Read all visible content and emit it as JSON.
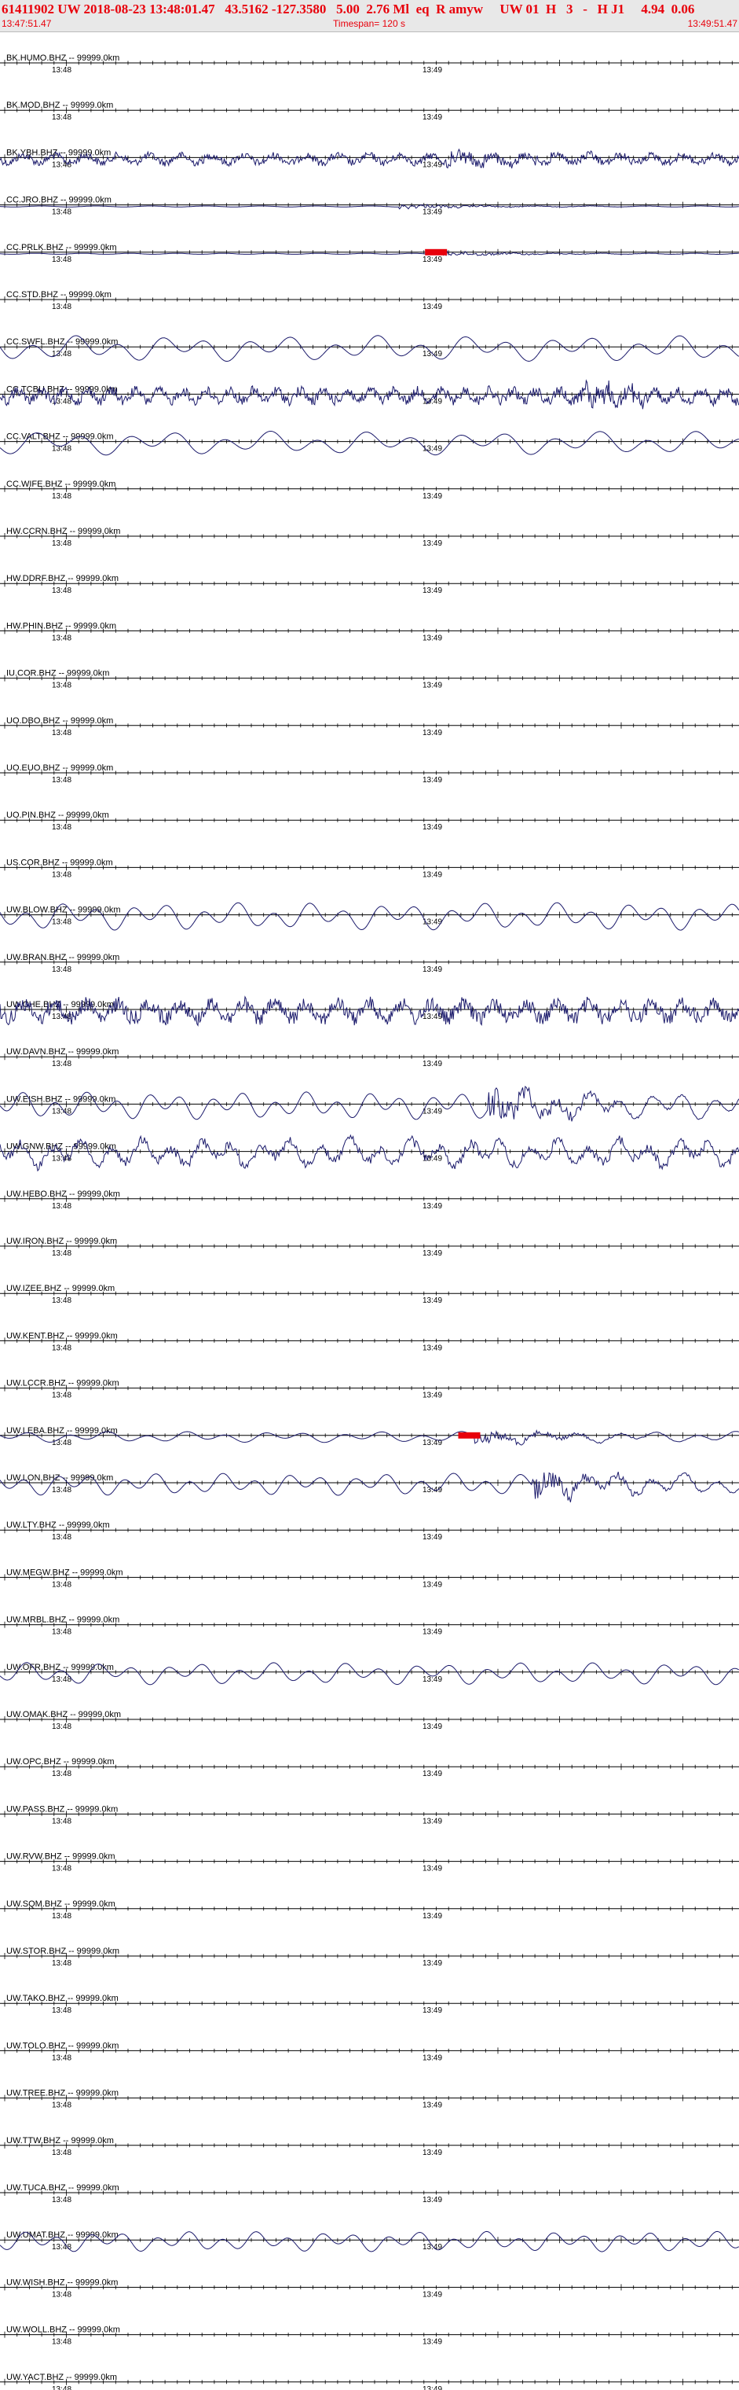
{
  "header": {
    "title": "61411902 UW 2018-08-23 13:48:01.47   43.5162 -127.3580   5.00  2.76 Ml  eq  R amyw     UW 01  H   3   -   H J1     4.94  0.06",
    "start_time": "13:47:51.47",
    "end_time": "13:49:51.47",
    "timespan": "Timespan= 120 s"
  },
  "tick_labels": {
    "first": "13:48",
    "second": "13:49"
  },
  "colors": {
    "trace": "#1b1a6b",
    "pick": "#e8000b",
    "header_text": "#e8000b",
    "axis": "#000000"
  },
  "chart_data": {
    "type": "line",
    "title": "61411902 UW 2018-08-23 13:48:01.47   43.5162 -127.3580   5.00  2.76 Ml  eq  R amyw     UW 01  H   3   -   H J1     4.94  0.06",
    "xlabel": "",
    "ylabel": "",
    "x_range": [
      "13:47:51.47",
      "13:49:51.47"
    ],
    "timespan_s": 120,
    "series": [
      {
        "name": "BK.HUMO.BHZ -- 99999.0km",
        "signal": "none",
        "amplitude": 0,
        "period": 0,
        "onset_frac": null,
        "pick_frac": null
      },
      {
        "name": "BK.MOD.BHZ -- 99999.0km",
        "signal": "none",
        "amplitude": 0,
        "period": 0,
        "onset_frac": null,
        "pick_frac": null
      },
      {
        "name": "BK.YBH.BHZ -- 99999.0km",
        "signal": "noise",
        "amplitude": 0.4,
        "period": 40,
        "onset_frac": 0.6,
        "pick_frac": null
      },
      {
        "name": "CC.JRO.BHZ -- 99999.0km",
        "signal": "quiet",
        "amplitude": 0.12,
        "period": 70,
        "onset_frac": 0.54,
        "pick_frac": null
      },
      {
        "name": "CC.PRLK.BHZ -- 99999.0km",
        "signal": "quiet",
        "amplitude": 0.12,
        "period": 60,
        "onset_frac": 0.6,
        "pick_frac": 0.59
      },
      {
        "name": "CC.STD.BHZ -- 99999.0km",
        "signal": "none",
        "amplitude": 0,
        "period": 0,
        "onset_frac": null,
        "pick_frac": null
      },
      {
        "name": "CC.SWFL.BHZ -- 99999.0km",
        "signal": "wave",
        "amplitude": 0.7,
        "period": 55,
        "onset_frac": null,
        "pick_frac": null
      },
      {
        "name": "CC.TCBU.BHZ -- 99999.0km",
        "signal": "noise",
        "amplitude": 0.55,
        "period": 30,
        "onset_frac": 0.78,
        "pick_frac": null
      },
      {
        "name": "CC.VALT.BHZ -- 99999.0km",
        "signal": "wave",
        "amplitude": 0.65,
        "period": 60,
        "onset_frac": null,
        "pick_frac": null
      },
      {
        "name": "CC.WIFE.BHZ -- 99999.0km",
        "signal": "none",
        "amplitude": 0,
        "period": 0,
        "onset_frac": null,
        "pick_frac": null
      },
      {
        "name": "HW.CCRN.BHZ -- 99999.0km",
        "signal": "none",
        "amplitude": 0,
        "period": 0,
        "onset_frac": null,
        "pick_frac": null
      },
      {
        "name": "HW.DDRF.BHZ -- 99999.0km",
        "signal": "none",
        "amplitude": 0,
        "period": 0,
        "onset_frac": null,
        "pick_frac": null
      },
      {
        "name": "HW.PHIN.BHZ -- 99999.0km",
        "signal": "none",
        "amplitude": 0,
        "period": 0,
        "onset_frac": null,
        "pick_frac": null
      },
      {
        "name": "IU.COR.BHZ -- 99999.0km",
        "signal": "none",
        "amplitude": 0,
        "period": 0,
        "onset_frac": null,
        "pick_frac": null
      },
      {
        "name": "UO.DBO.BHZ -- 99999.0km",
        "signal": "none",
        "amplitude": 0,
        "period": 0,
        "onset_frac": null,
        "pick_frac": null
      },
      {
        "name": "UO.EUO.BHZ -- 99999.0km",
        "signal": "none",
        "amplitude": 0,
        "period": 0,
        "onset_frac": null,
        "pick_frac": null
      },
      {
        "name": "UO.PIN.BHZ -- 99999.0km",
        "signal": "none",
        "amplitude": 0,
        "period": 0,
        "onset_frac": null,
        "pick_frac": null
      },
      {
        "name": "US.COR.BHZ -- 99999.0km",
        "signal": "none",
        "amplitude": 0,
        "period": 0,
        "onset_frac": null,
        "pick_frac": null
      },
      {
        "name": "UW.BLOW.BHZ -- 99999.0km",
        "signal": "wave",
        "amplitude": 0.75,
        "period": 45,
        "onset_frac": null,
        "pick_frac": null
      },
      {
        "name": "UW.BRAN.BHZ -- 99999.0km",
        "signal": "none",
        "amplitude": 0,
        "period": 0,
        "onset_frac": null,
        "pick_frac": null
      },
      {
        "name": "UW.CHE.BHZ -- 99999.0km",
        "signal": "noise",
        "amplitude": 0.8,
        "period": 40,
        "onset_frac": null,
        "pick_frac": null
      },
      {
        "name": "UW.DAVN.BHZ -- 99999.0km",
        "signal": "none",
        "amplitude": 0,
        "period": 0,
        "onset_frac": null,
        "pick_frac": null
      },
      {
        "name": "UW.EISH.BHZ -- 99999.0km",
        "signal": "wave",
        "amplitude": 0.75,
        "period": 40,
        "onset_frac": 0.66,
        "pick_frac": null
      },
      {
        "name": "UW.GNW.BHZ -- 99999.0km",
        "signal": "noisy-wave",
        "amplitude": 0.75,
        "period": 38,
        "onset_frac": null,
        "pick_frac": null
      },
      {
        "name": "UW.HEBO.BHZ -- 99999.0km",
        "signal": "none",
        "amplitude": 0,
        "period": 0,
        "onset_frac": null,
        "pick_frac": null
      },
      {
        "name": "UW.IRON.BHZ -- 99999.0km",
        "signal": "none",
        "amplitude": 0,
        "period": 0,
        "onset_frac": null,
        "pick_frac": null
      },
      {
        "name": "UW.IZEE.BHZ -- 99999.0km",
        "signal": "none",
        "amplitude": 0,
        "period": 0,
        "onset_frac": null,
        "pick_frac": null
      },
      {
        "name": "UW.KENT.BHZ -- 99999.0km",
        "signal": "none",
        "amplitude": 0,
        "period": 0,
        "onset_frac": null,
        "pick_frac": null
      },
      {
        "name": "UW.LCCR.BHZ -- 99999.0km",
        "signal": "none",
        "amplitude": 0,
        "period": 0,
        "onset_frac": null,
        "pick_frac": null
      },
      {
        "name": "UW.LEBA.BHZ -- 99999.0km",
        "signal": "wave",
        "amplitude": 0.3,
        "period": 50,
        "onset_frac": 0.64,
        "pick_frac": 0.635
      },
      {
        "name": "UW.LON.BHZ -- 99999.0km",
        "signal": "wave",
        "amplitude": 0.6,
        "period": 42,
        "onset_frac": 0.72,
        "pick_frac": null
      },
      {
        "name": "UW.LTY.BHZ -- 99999.0km",
        "signal": "none",
        "amplitude": 0,
        "period": 0,
        "onset_frac": null,
        "pick_frac": null
      },
      {
        "name": "UW.MEGW.BHZ -- 99999.0km",
        "signal": "none",
        "amplitude": 0,
        "period": 0,
        "onset_frac": null,
        "pick_frac": null
      },
      {
        "name": "UW.MRBL.BHZ -- 99999.0km",
        "signal": "none",
        "amplitude": 0,
        "period": 0,
        "onset_frac": null,
        "pick_frac": null
      },
      {
        "name": "UW.OFR.BHZ -- 99999.0km",
        "signal": "wave",
        "amplitude": 0.6,
        "period": 45,
        "onset_frac": null,
        "pick_frac": null
      },
      {
        "name": "UW.OMAK.BHZ -- 99999.0km",
        "signal": "none",
        "amplitude": 0,
        "period": 0,
        "onset_frac": null,
        "pick_frac": null
      },
      {
        "name": "UW.OPC.BHZ -- 99999.0km",
        "signal": "none",
        "amplitude": 0,
        "period": 0,
        "onset_frac": null,
        "pick_frac": null
      },
      {
        "name": "UW.PASS.BHZ -- 99999.0km",
        "signal": "none",
        "amplitude": 0,
        "period": 0,
        "onset_frac": null,
        "pick_frac": null
      },
      {
        "name": "UW.RVW.BHZ -- 99999.0km",
        "signal": "none",
        "amplitude": 0,
        "period": 0,
        "onset_frac": null,
        "pick_frac": null
      },
      {
        "name": "UW.SQM.BHZ -- 99999.0km",
        "signal": "none",
        "amplitude": 0,
        "period": 0,
        "onset_frac": null,
        "pick_frac": null
      },
      {
        "name": "UW.STOR.BHZ -- 99999.0km",
        "signal": "none",
        "amplitude": 0,
        "period": 0,
        "onset_frac": null,
        "pick_frac": null
      },
      {
        "name": "UW.TAKO.BHZ -- 99999.0km",
        "signal": "none",
        "amplitude": 0,
        "period": 0,
        "onset_frac": null,
        "pick_frac": null
      },
      {
        "name": "UW.TOLO.BHZ -- 99999.0km",
        "signal": "none",
        "amplitude": 0,
        "period": 0,
        "onset_frac": null,
        "pick_frac": null
      },
      {
        "name": "UW.TREE.BHZ -- 99999.0km",
        "signal": "none",
        "amplitude": 0,
        "period": 0,
        "onset_frac": null,
        "pick_frac": null
      },
      {
        "name": "UW.TTW.BHZ -- 99999.0km",
        "signal": "none",
        "amplitude": 0,
        "period": 0,
        "onset_frac": null,
        "pick_frac": null
      },
      {
        "name": "UW.TUCA.BHZ -- 99999.0km",
        "signal": "none",
        "amplitude": 0,
        "period": 0,
        "onset_frac": null,
        "pick_frac": null
      },
      {
        "name": "UW.UMAT.BHZ -- 99999.0km",
        "signal": "wave",
        "amplitude": 0.55,
        "period": 42,
        "onset_frac": null,
        "pick_frac": null
      },
      {
        "name": "UW.WISH.BHZ -- 99999.0km",
        "signal": "none",
        "amplitude": 0,
        "period": 0,
        "onset_frac": null,
        "pick_frac": null
      },
      {
        "name": "UW.WOLL.BHZ -- 99999.0km",
        "signal": "none",
        "amplitude": 0,
        "period": 0,
        "onset_frac": null,
        "pick_frac": null
      },
      {
        "name": "UW.YACT.BHZ -- 99999.0km",
        "signal": "none",
        "amplitude": 0,
        "period": 0,
        "onset_frac": null,
        "pick_frac": null
      }
    ]
  }
}
